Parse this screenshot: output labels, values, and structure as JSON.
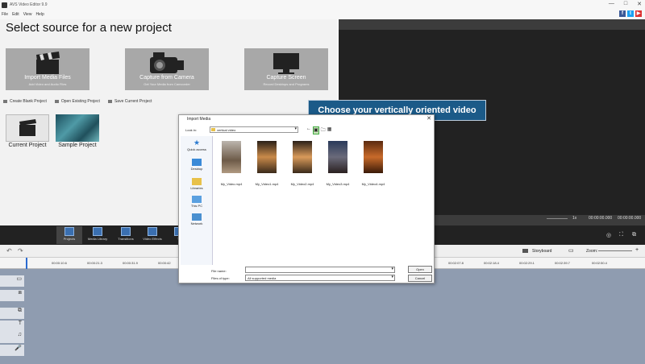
{
  "window": {
    "title": "AVS Video Editor 9.9",
    "controls": [
      "—",
      "□",
      "✕"
    ]
  },
  "menu": [
    "File",
    "Edit",
    "View",
    "Help"
  ],
  "social": [
    {
      "label": "f",
      "color": "#3b5998"
    },
    {
      "label": "t",
      "color": "#1da1f2"
    },
    {
      "label": "▶",
      "color": "#d33"
    }
  ],
  "source": {
    "heading": "Select source for a new project",
    "tiles": [
      {
        "title": "Import Media Files",
        "subtitle": "Add Video and Audio Files",
        "icon": "clapperboard-icon"
      },
      {
        "title": "Capture from Camera",
        "subtitle": "Get Your Media from Camcorder",
        "icon": "camera-icon"
      },
      {
        "title": "Capture Screen",
        "subtitle": "Record Desktops and Programs",
        "icon": "monitor-icon"
      }
    ],
    "project_actions": [
      "Create Blank Project",
      "Open Existing Project",
      "Save Current Project"
    ],
    "projects": [
      "Current Project",
      "Sample Project"
    ]
  },
  "preview": {
    "speed": "1x",
    "time_current": "00:00:00.000",
    "time_total": "00:00:00.000"
  },
  "tools": [
    "Projects",
    "Media Library",
    "Transitions",
    "Video Effects",
    "Te"
  ],
  "timeline": {
    "storyboard_label": "Storyboard",
    "zoom_label": "Zoom:",
    "ruler": [
      "00:00:10.6",
      "00:00:21.3",
      "00:00:31.9",
      "00:00:42",
      "00:02:07.8",
      "00:02:18.4",
      "00:02:29.1",
      "00:02:39.7",
      "00:02:50.4"
    ]
  },
  "callout": "Choose your vertically oriented video",
  "dialog": {
    "title": "Import Media",
    "look_in_label": "Look in:",
    "look_in_value": "vertical video",
    "places": [
      "Quick access",
      "Desktop",
      "Libraries",
      "This PC",
      "Network"
    ],
    "files": [
      "My_Video.mp4",
      "My_Video1.mp4",
      "My_Video2.mp4",
      "My_Video3.mp4",
      "My_Video4.mp4"
    ],
    "file_name_label": "File name:",
    "file_name_value": "",
    "file_type_label": "Files of type:",
    "file_type_value": "All supported media",
    "open_label": "Open",
    "cancel_label": "Cancel"
  },
  "colors": {
    "accent": "#1b5a88",
    "tile": "#a8a8a8",
    "timeline": "#8f9cb0",
    "toolband": "#222222"
  }
}
